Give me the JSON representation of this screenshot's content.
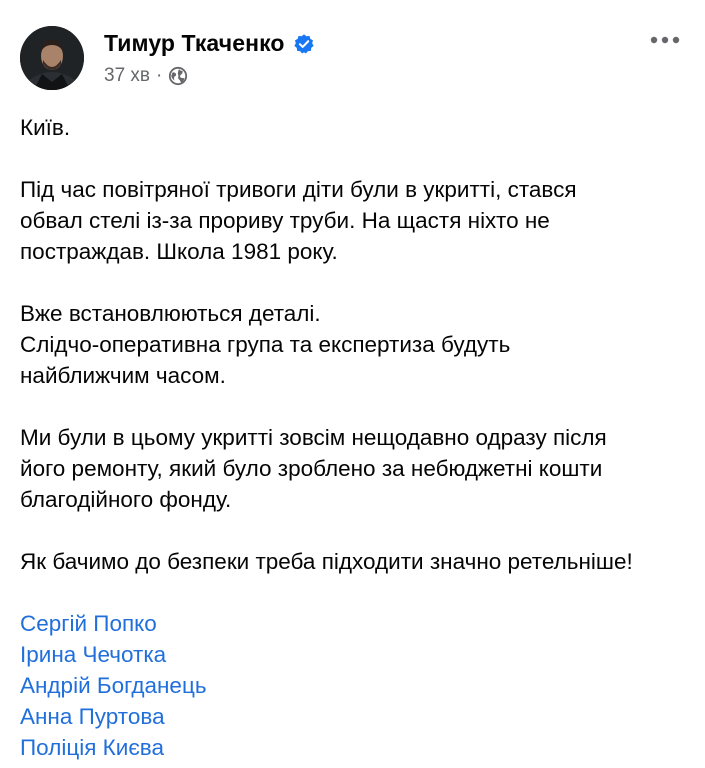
{
  "post": {
    "author_name": "Тимур Ткаченко",
    "timestamp": "37 хв",
    "separator": "·",
    "privacy_icon": "globe-icon",
    "verified_icon": "verified-badge-icon",
    "more_icon": "more-options-icon",
    "paragraphs": [
      [
        "Київ."
      ],
      [
        "Під час повітряної тривоги діти були в укритті, стався",
        "обвал стелі із-за прориву труби. На щастя ніхто не",
        "постраждав. Школа 1981 року."
      ],
      [
        "Вже встановлюються деталі.",
        "Слідчо-оперативна група та експертиза будуть",
        "найближчим часом."
      ],
      [
        "Ми були в цьому укритті зовсім нещодавно одразу після",
        "його ремонту, який було зроблено за небюджетні кошти",
        "благодійного фонду."
      ],
      [
        "Як бачимо до безпеки треба підходити значно ретельніше!"
      ]
    ],
    "tags": [
      "Сергій Попко",
      "Ірина Чечотка",
      "Андрій Богданець",
      "Анна Пуртова",
      "Поліція Києва"
    ]
  },
  "colors": {
    "text": "#050505",
    "secondary_text": "#65676b",
    "link": "#216fdb",
    "verified": "#1877f2"
  }
}
